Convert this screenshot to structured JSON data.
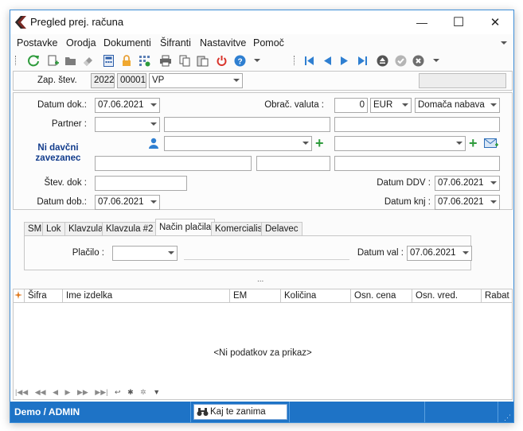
{
  "window": {
    "title": "Pregled prej. računa",
    "controls": [
      "—",
      "☐",
      "✕"
    ]
  },
  "menu": [
    "Postavke",
    "Orodja",
    "Dokumenti",
    "Šifranti",
    "Nastavitve",
    "Pomoč"
  ],
  "header": {
    "zap_label": "Zap. štev.",
    "year": "2022",
    "number": "00001",
    "type": "VP"
  },
  "form": {
    "datum_dok_label": "Datum dok.:",
    "datum_dok": "07.06.2021",
    "obrac_valuta_label": "Obrač. valuta :",
    "rate": "0",
    "currency": "EUR",
    "nabava": "Domača nabava",
    "partner_label": "Partner :",
    "ni_davcni": "Ni davčni zavezanec",
    "stev_dok_label": "Štev. dok :",
    "datum_ddv_label": "Datum DDV :",
    "datum_ddv": "07.06.2021",
    "datum_dob_label": "Datum dob.:",
    "datum_dob": "07.06.2021",
    "datum_knj_label": "Datum knj :",
    "datum_knj": "07.06.2021"
  },
  "tabs": [
    "SM",
    "Lok",
    "Klavzula",
    "Klavzula #2",
    "Način plačila",
    "Komercialist",
    "Delavec"
  ],
  "payment": {
    "placilo_label": "Plačilo :",
    "datum_val_label": "Datum val :",
    "datum_val": "07.06.2021"
  },
  "splitter": "...",
  "grid": {
    "columns": [
      "Šifra",
      "Ime izdelka",
      "EM",
      "Količina",
      "Osn. cena",
      "Osn. vred.",
      "Rabat"
    ],
    "empty_text": "<Ni podatkov za prikaz>"
  },
  "status": {
    "user": "Demo / ADMIN",
    "search_label": "Kaj te zanima"
  },
  "colors": {
    "accent": "#1e73c6",
    "title_blue": "#123c8c",
    "green": "#2e9b3c",
    "red": "#d9342b"
  }
}
